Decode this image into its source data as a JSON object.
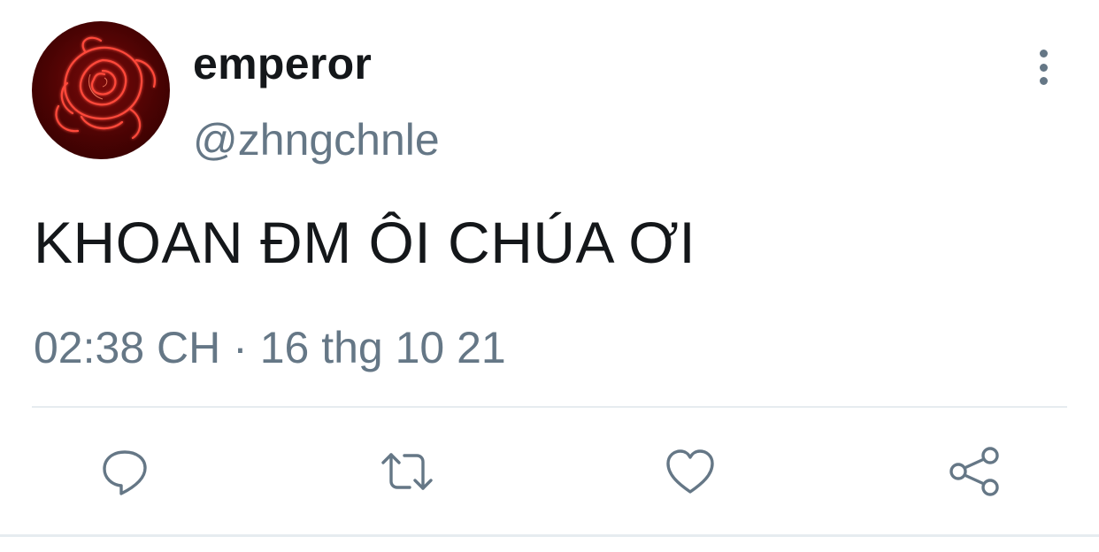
{
  "user": {
    "display_name": "emperor",
    "handle": "@zhngchnle",
    "avatar": "neon-rose-avatar"
  },
  "tweet": {
    "text": "KHOAN ĐM ÔI CHÚA ƠI",
    "time": "02:38 CH",
    "separator": "·",
    "date": "16 thg 10 21"
  },
  "icons": {
    "more": "more-vertical-icon",
    "reply": "reply-icon",
    "retweet": "retweet-icon",
    "like": "heart-icon",
    "share": "share-icon"
  },
  "colors": {
    "text_primary": "#14171a",
    "text_secondary": "#657786",
    "divider": "#e6ecf0",
    "avatar_neon": "#ff3b30"
  }
}
